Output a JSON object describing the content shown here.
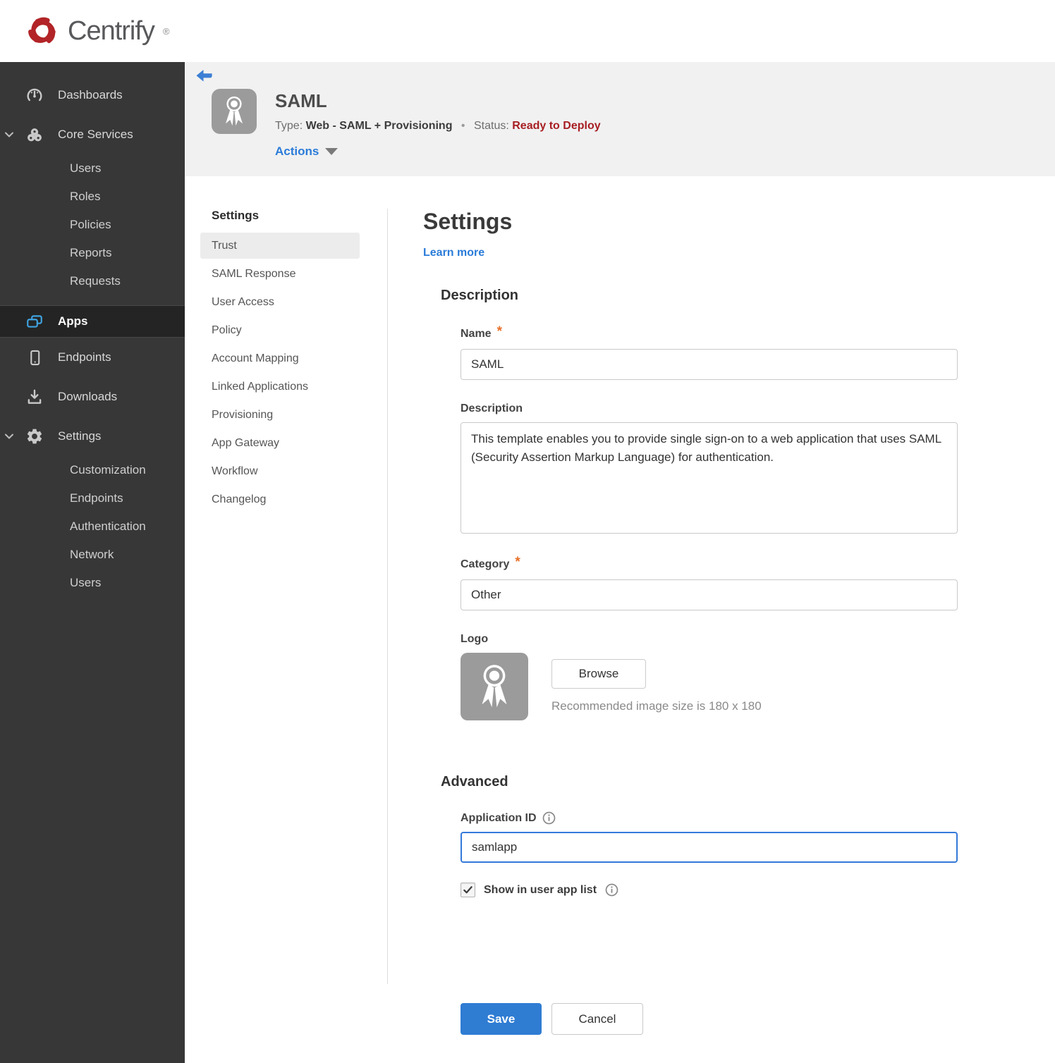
{
  "brand": {
    "name": "Centrify",
    "registered_mark": "®",
    "logo_red": "#b22427"
  },
  "sidebar": {
    "items": [
      {
        "label": "Dashboards",
        "icon": "gauge-icon"
      },
      {
        "label": "Core Services",
        "icon": "core-services-icon",
        "expanded": true,
        "children": [
          "Users",
          "Roles",
          "Policies",
          "Reports",
          "Requests"
        ]
      },
      {
        "label": "Apps",
        "icon": "apps-icon",
        "active": true
      },
      {
        "label": "Endpoints",
        "icon": "mobile-icon"
      },
      {
        "label": "Downloads",
        "icon": "download-icon"
      },
      {
        "label": "Settings",
        "icon": "gear-icon",
        "expanded": true,
        "children": [
          "Customization",
          "Endpoints",
          "Authentication",
          "Network",
          "Users"
        ]
      }
    ]
  },
  "header": {
    "title": "SAML",
    "type_label": "Type:",
    "type_value": "Web - SAML + Provisioning",
    "separator": "•",
    "status_label": "Status:",
    "status_value": "Ready to Deploy",
    "status_color": "#a71f23",
    "actions_label": "Actions"
  },
  "subnav": {
    "title": "Settings",
    "active_item": "Trust",
    "items": [
      "Trust",
      "SAML Response",
      "User Access",
      "Policy",
      "Account Mapping",
      "Linked Applications",
      "Provisioning",
      "App Gateway",
      "Workflow",
      "Changelog"
    ]
  },
  "main": {
    "title": "Settings",
    "learn_more_label": "Learn more",
    "required_marker": "*",
    "description_section": {
      "title": "Description",
      "name_label": "Name",
      "name_value": "SAML",
      "description_label": "Description",
      "description_value": "This template enables you to provide single sign-on to a web application that uses SAML (Security Assertion Markup Language) for authentication.",
      "category_label": "Category",
      "category_value": "Other",
      "logo_label": "Logo",
      "browse_label": "Browse",
      "logo_hint": "Recommended image size is 180 x 180"
    },
    "advanced_section": {
      "title": "Advanced",
      "application_id_label": "Application ID",
      "application_id_value": "samlapp",
      "application_id_focused": true,
      "show_in_user_app_list_label": "Show in user app list",
      "show_in_user_app_list_checked": true
    },
    "save_label": "Save",
    "cancel_label": "Cancel"
  },
  "colors": {
    "accent_blue": "#2b7cd9",
    "save_button_blue": "#2f7cd3",
    "sidebar_bg": "#373737",
    "sidebar_active_bg": "#242424",
    "app_header_bg": "#f1f1f1",
    "selected_subnav_bg": "#ececec",
    "status_red": "#a71f23",
    "brand_red": "#b22427",
    "apps_icon_blue": "#3fa3e0"
  }
}
